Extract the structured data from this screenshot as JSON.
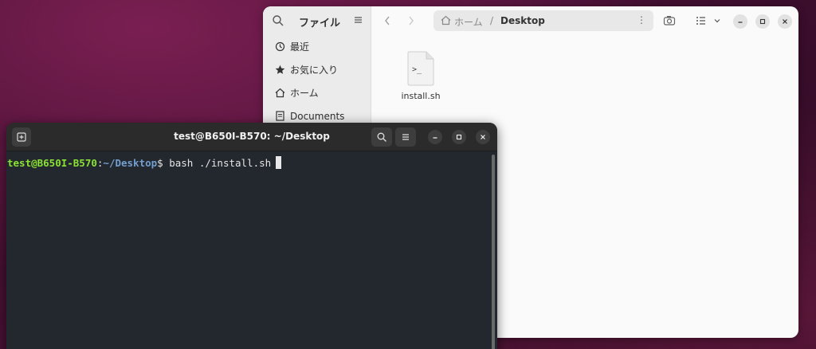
{
  "files_window": {
    "sidebar": {
      "title": "ファイル",
      "items": [
        {
          "label": "最近",
          "icon": "clock-icon"
        },
        {
          "label": "お気に入り",
          "icon": "star-icon"
        },
        {
          "label": "ホーム",
          "icon": "home-icon"
        },
        {
          "label": "Documents",
          "icon": "document-icon"
        }
      ]
    },
    "pathbar": {
      "home": "ホーム",
      "separator": "/",
      "current": "Desktop"
    },
    "files": [
      {
        "name": "install.sh",
        "icon": "script-file-icon",
        "glyph": ">_"
      }
    ]
  },
  "terminal": {
    "title": "test@B650I-B570: ~/Desktop",
    "prompt_user": "test@B650I-B570",
    "prompt_sep": ":",
    "prompt_path": "~/Desktop",
    "prompt_symbol": "$",
    "command": " bash ./install.sh"
  },
  "colors": {
    "prompt_user": "#8ae234",
    "prompt_path": "#729fcf",
    "terminal_bg": "#23272e"
  }
}
